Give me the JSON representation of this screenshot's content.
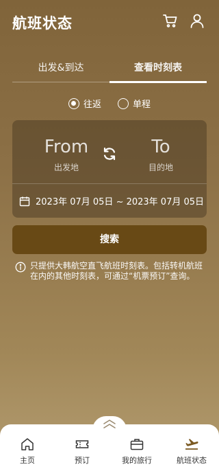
{
  "header": {
    "title": "航班状态",
    "icons": [
      "cart-icon",
      "user-icon"
    ]
  },
  "tabs": [
    {
      "label": "出发&到达",
      "active": false
    },
    {
      "label": "查看时刻表",
      "active": true
    }
  ],
  "trip_type": {
    "options": [
      {
        "label": "往返",
        "selected": true
      },
      {
        "label": "单程",
        "selected": false
      }
    ]
  },
  "route": {
    "from_code": "From",
    "from_label": "出发地",
    "to_code": "To",
    "to_label": "目的地",
    "date_range": "2023年 07月 05日 ~ 2023年 07月 05日"
  },
  "search_label": "搜索",
  "notice": "只提供大韩航空直飞航班时刻表。包括转机航班在内的其他时刻表，可通过“机票预订”查询。",
  "bottom_nav": [
    {
      "label": "主页",
      "icon": "home-icon"
    },
    {
      "label": "预订",
      "icon": "ticket-icon"
    },
    {
      "label": "我的旅行",
      "icon": "suitcase-icon"
    },
    {
      "label": "航班状态",
      "icon": "airplane-icon",
      "active": true
    }
  ],
  "colors": {
    "background_top": "#80643a",
    "background_bottom": "#b39c70",
    "search_button": "#684915",
    "active_nav_icon": "#7b5a22"
  }
}
